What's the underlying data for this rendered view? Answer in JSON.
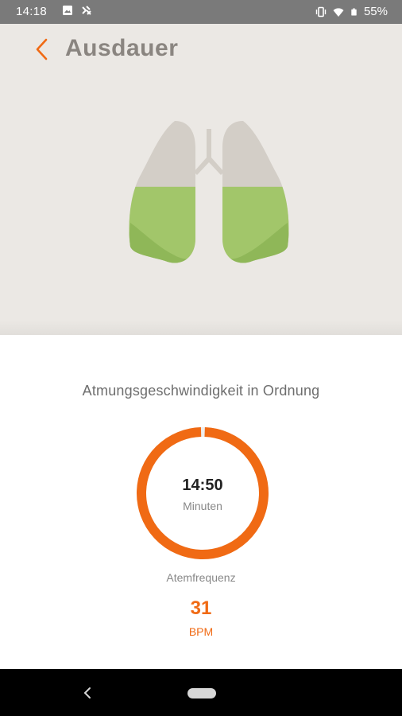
{
  "status_bar": {
    "time": "14:18",
    "battery": "55%",
    "icons": [
      "image-icon",
      "app-notification-icon",
      "vibrate-icon",
      "wifi-icon",
      "battery-icon"
    ]
  },
  "header": {
    "title": "Ausdauer",
    "back_icon": "chevron-left-icon"
  },
  "illustration": {
    "name": "lungs",
    "fill_level": 0.55,
    "colors": {
      "empty": "#d3cec7",
      "filled": "#a2c66a",
      "filled_dark": "#8db557"
    }
  },
  "main": {
    "status_message": "Atmungsgeschwindigkeit in Ordnung",
    "timer": {
      "value": "14:50",
      "unit": "Minuten",
      "progress": 0.99
    },
    "respiration": {
      "label": "Atemfrequenz",
      "value": "31",
      "unit": "BPM"
    }
  },
  "colors": {
    "accent": "#f06a14",
    "hero_bg": "#ebe8e4"
  },
  "nav_bar": {
    "back_icon": "nav-back-icon",
    "home_icon": "nav-home-pill"
  }
}
